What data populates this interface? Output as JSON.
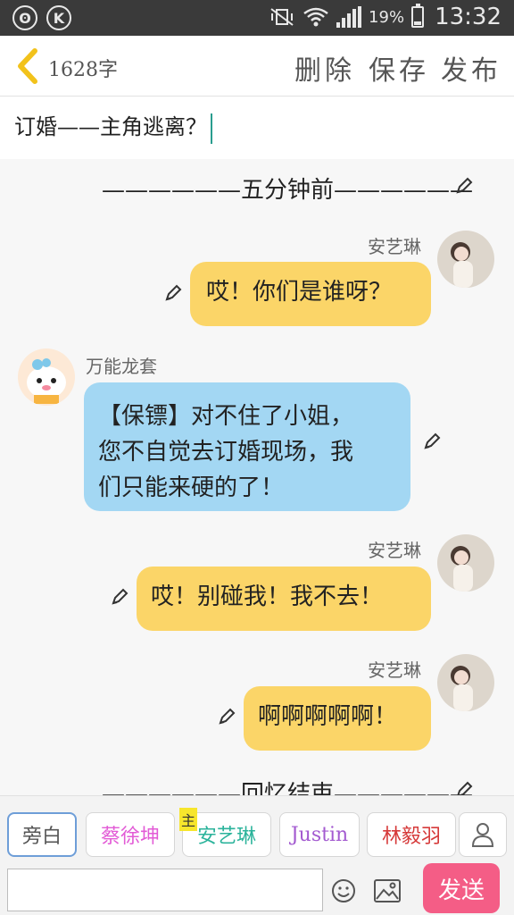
{
  "status_bar": {
    "left_icons": [
      "weibo-icon",
      "k-icon"
    ],
    "battery": "19%",
    "time": "13:32"
  },
  "header": {
    "word_count": "1628字",
    "actions": {
      "delete": "删除",
      "save": "保存",
      "publish": "发布"
    }
  },
  "title": "订婚——主角逃离？",
  "chat": {
    "divider_top": "——————五分钟前——————",
    "divider_bottom": "——————回忆结束——————",
    "messages": [
      {
        "name": "安艺琳",
        "text": "哎！你们是谁呀？",
        "side": "right",
        "color": "#fbd568"
      },
      {
        "name": "万能龙套",
        "line1": "【保镖】对不住了小姐，",
        "line2": "您不自觉去订婚现场，我",
        "line3": "们只能来硬的了！",
        "side": "left",
        "color": "#a3d7f3"
      },
      {
        "name": "安艺琳",
        "text": "哎！别碰我！我不去！",
        "side": "right",
        "color": "#fbd568"
      },
      {
        "name": "安艺琳",
        "text": "啊啊啊啊啊！",
        "side": "right",
        "color": "#fbd568"
      }
    ]
  },
  "roles": {
    "narrator": "旁白",
    "r1": "蔡徐坤",
    "main_tag": "主",
    "r2": "安艺琳",
    "r3": "Justin",
    "r4": "林毅羽",
    "colors": {
      "r1": "#e25bd6",
      "r2": "#2bb39b",
      "r3": "#a35ad0",
      "r4": "#d63a3a"
    }
  },
  "input": {
    "value": "",
    "send": "发送"
  }
}
